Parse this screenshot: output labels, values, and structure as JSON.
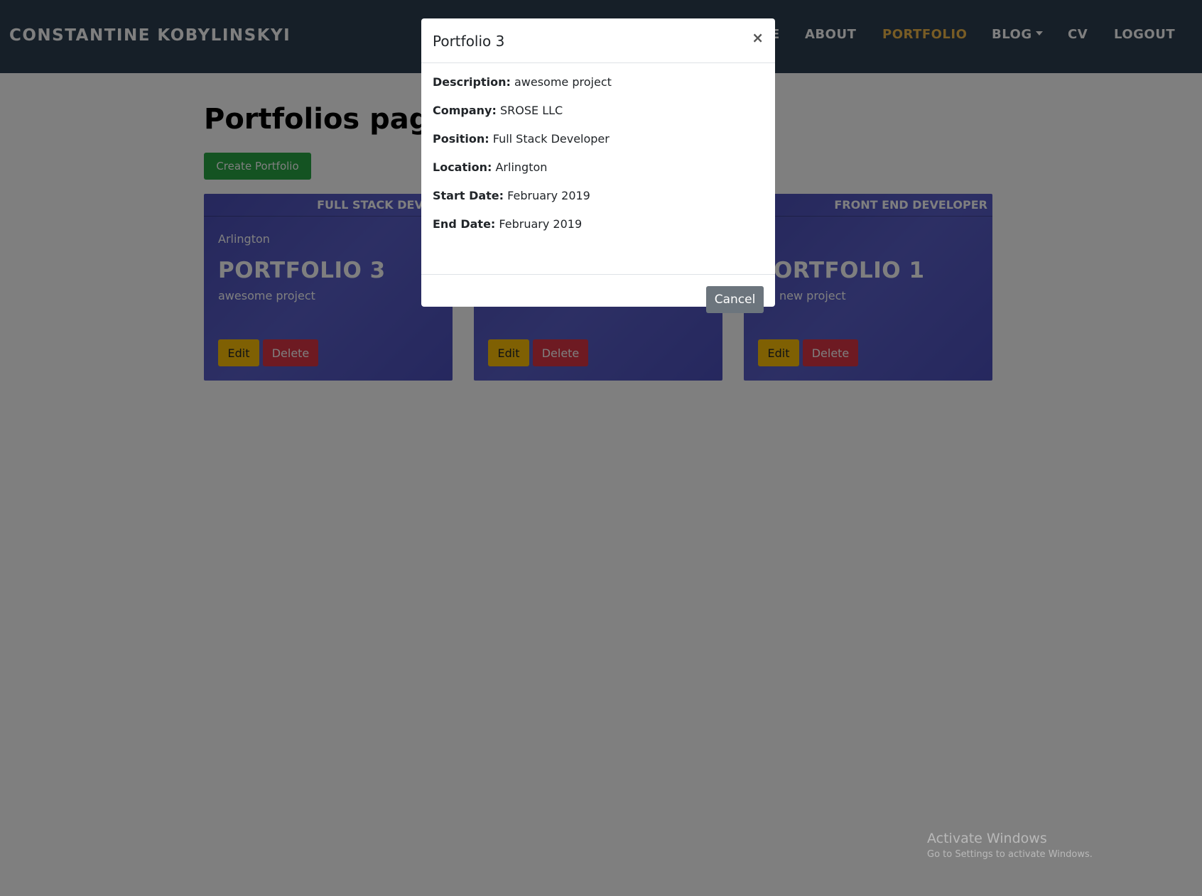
{
  "navbar": {
    "brand": "CONSTANTINE KOBYLINSKYI",
    "partial_item": "E",
    "items": [
      {
        "label": "ABOUT"
      },
      {
        "label": "PORTFOLIO"
      },
      {
        "label": "BLOG"
      },
      {
        "label": "CV"
      },
      {
        "label": "LOGOUT"
      }
    ]
  },
  "main": {
    "title": "Portfolios page",
    "create_label": "Create Portfolio",
    "cards": [
      {
        "position": "FULL STACK DEVELO",
        "location": "Arlington",
        "title": "PORTFOLIO 3",
        "description": "awesome project",
        "edit_label": "Edit",
        "delete_label": "Delete"
      },
      {
        "position": "",
        "location": "",
        "title": "",
        "description": "",
        "edit_label": "Edit",
        "delete_label": "Delete"
      },
      {
        "position": "FRONT END DEVELOPER",
        "location": "",
        "title": "ORTFOLIO 1",
        "description": "new project",
        "edit_label": "Edit",
        "delete_label": "Delete"
      }
    ]
  },
  "modal": {
    "title": "Portfolio 3",
    "close_symbol": "×",
    "details": [
      {
        "label": "Description:",
        "value": "awesome project"
      },
      {
        "label": "Company:",
        "value": "SROSE LLC"
      },
      {
        "label": "Position:",
        "value": "Full Stack Developer"
      },
      {
        "label": "Location:",
        "value": "Arlington"
      },
      {
        "label": "Start Date:",
        "value": "February 2019"
      },
      {
        "label": "End Date:",
        "value": "February 2019"
      }
    ],
    "cancel_label": "Cancel"
  },
  "watermark": {
    "title": "Activate Windows",
    "subtitle": "Go to Settings to activate Windows."
  },
  "colors": {
    "navbar_bg": "#2c3e50",
    "active_nav": "#f0b84b",
    "card_bg": "#4f53bf",
    "create_button": "#28a745",
    "edit_button": "#ffc107",
    "delete_button": "#dc3545",
    "cancel_button": "#6c757d"
  }
}
